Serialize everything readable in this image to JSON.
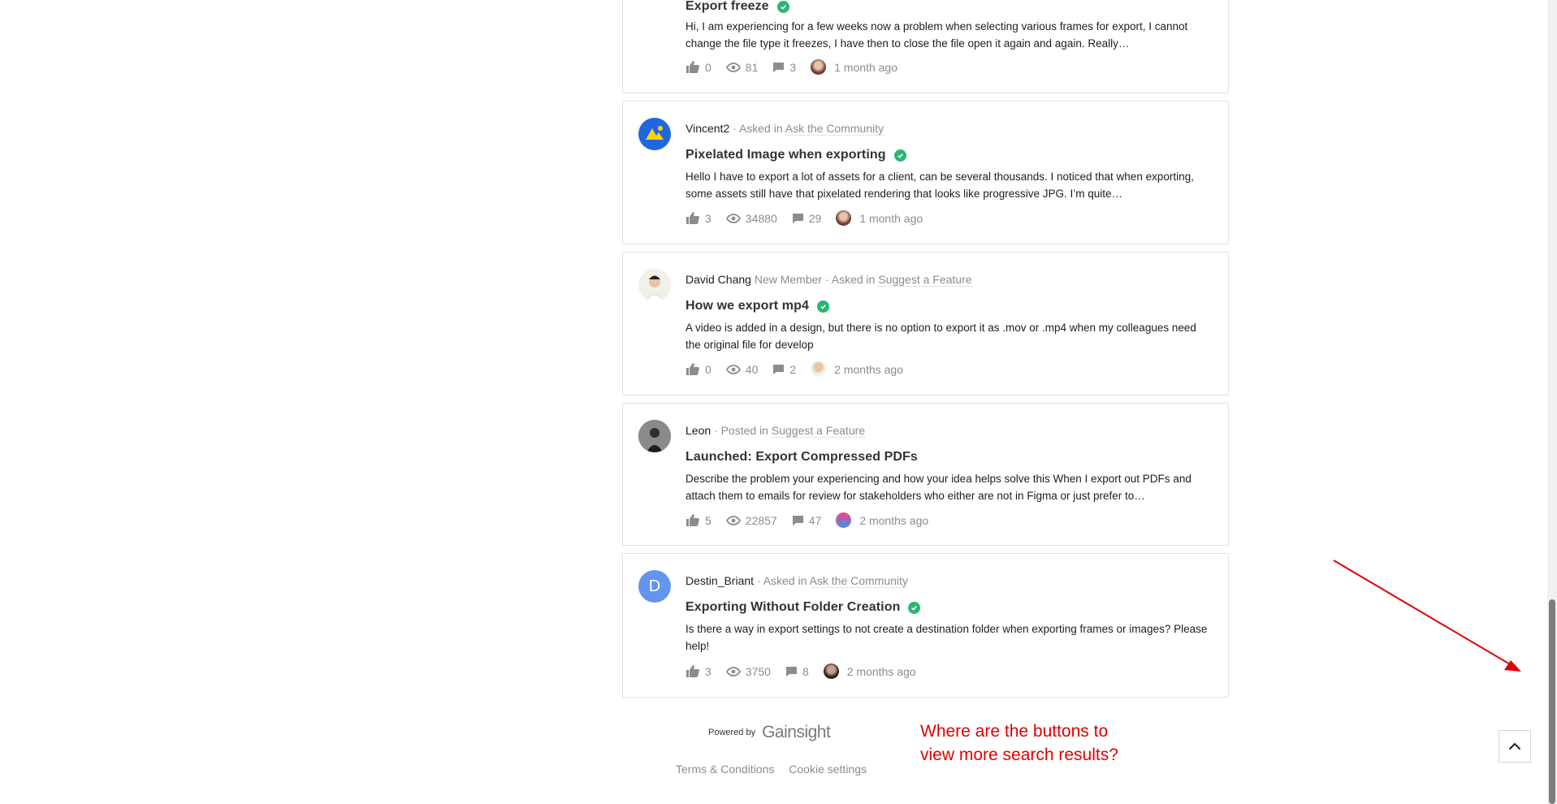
{
  "posts": [
    {
      "author": "",
      "title": "Export freeze",
      "solved": true,
      "excerpt": "Hi, I am experiencing for a few weeks now a problem when selecting various frames for export, I cannot change the file type it freezes, I have then to close the file open it again and again. Really…",
      "likes": "0",
      "views": "81",
      "comments": "3",
      "time": "1 month ago"
    },
    {
      "author": "Vincent2",
      "badge": "",
      "verb": "· Asked in",
      "category": "Ask the Community",
      "title": "Pixelated Image when exporting",
      "solved": true,
      "excerpt": "Hello I have to export a lot of assets for a client, can be several thousands. I noticed that when exporting, some assets still have that pixelated rendering that looks like progressive JPG. I’m quite…",
      "likes": "3",
      "views": "34880",
      "comments": "29",
      "time": "1 month ago"
    },
    {
      "author": "David Chang",
      "badge": "New Member",
      "verb": "· Asked in",
      "category": "Suggest a Feature",
      "title": "How we export mp4",
      "solved": true,
      "excerpt": "A video is added in a design, but there is no option to export it as .mov or .mp4 when my colleagues need the original file for develop",
      "likes": "0",
      "views": "40",
      "comments": "2",
      "time": "2 months ago"
    },
    {
      "author": "Leon",
      "badge": "",
      "verb": "· Posted in",
      "category": "Suggest a Feature",
      "title": "Launched: Export Compressed PDFs",
      "solved": false,
      "excerpt": "Describe the problem your experiencing and how your idea helps solve this When I export out PDFs and attach them to emails for review for stakeholders who either are not in Figma or just prefer to…",
      "likes": "5",
      "views": "22857",
      "comments": "47",
      "time": "2 months ago"
    },
    {
      "author": "Destin_Briant",
      "badge": "",
      "verb": "· Asked in",
      "category": "Ask the Community",
      "avatar_letter": "D",
      "title": "Exporting Without Folder Creation",
      "solved": true,
      "excerpt": "Is there a way in export settings to not create a destination folder when exporting frames or images? Please help!",
      "likes": "3",
      "views": "3750",
      "comments": "8",
      "time": "2 months ago"
    }
  ],
  "footer": {
    "powered_by": "Powered by",
    "brand": "Gainsight",
    "terms": "Terms & Conditions",
    "cookies": "Cookie settings"
  },
  "annotation": {
    "line1": "Where are the buttons to",
    "line2": "view more search results?"
  },
  "colors": {
    "accent_green": "#2bb673",
    "annotation_red": "#e10000",
    "muted_text": "#8c8c8c"
  },
  "icons": [
    "thumbs-up-icon",
    "eye-icon",
    "comment-icon",
    "checkmark-icon",
    "chevron-up-icon"
  ]
}
